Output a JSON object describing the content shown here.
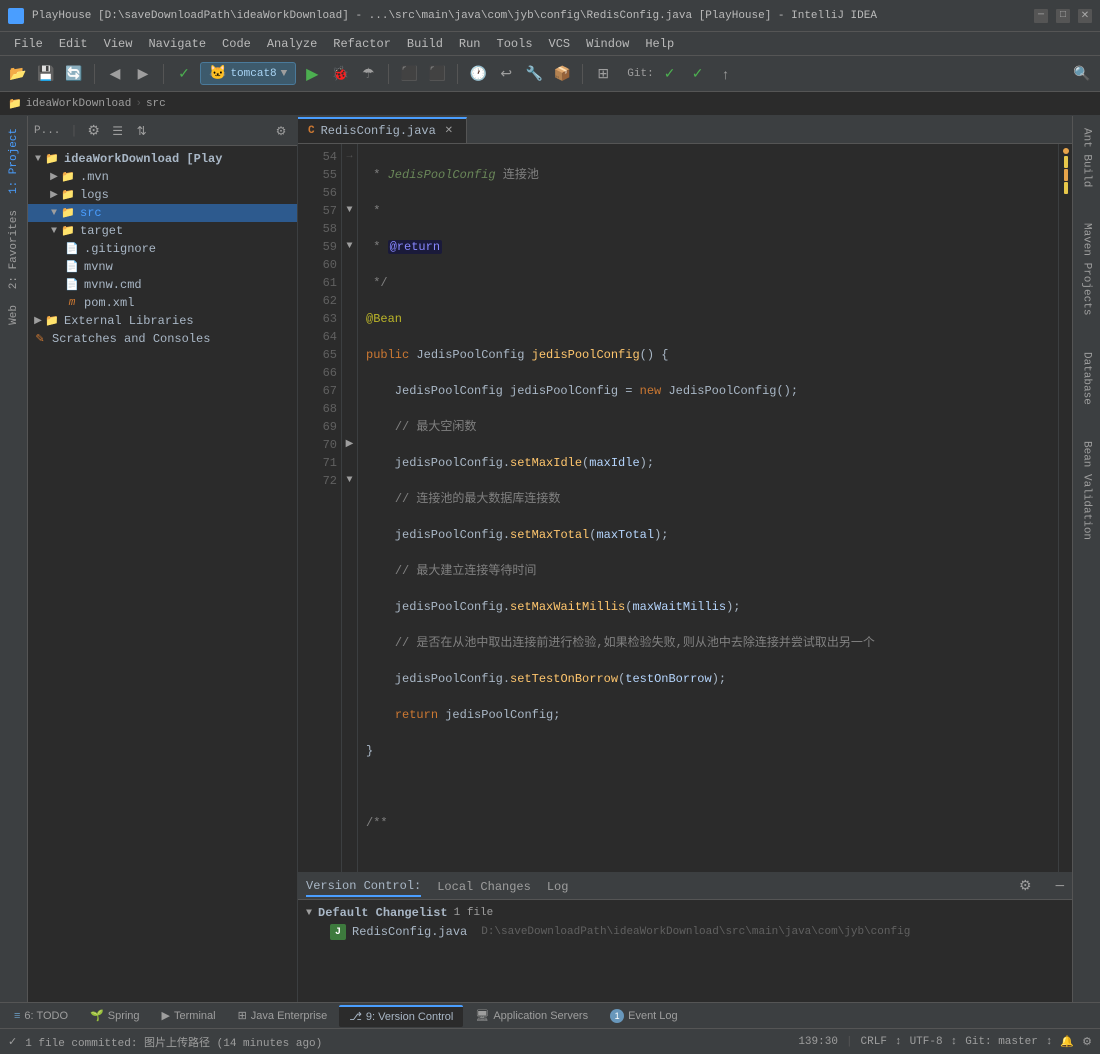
{
  "titleBar": {
    "title": "PlayHouse [D:\\saveDownloadPath\\ideaWorkDownload] - ...\\src\\main\\java\\com\\jyb\\config\\RedisConfig.java [PlayHouse] - IntelliJ IDEA"
  },
  "menuBar": {
    "items": [
      "File",
      "Edit",
      "View",
      "Navigate",
      "Code",
      "Analyze",
      "Refactor",
      "Build",
      "Run",
      "Tools",
      "VCS",
      "Window",
      "Help"
    ]
  },
  "toolbar": {
    "runConfig": "tomcat8",
    "gitLabel": "Git:"
  },
  "breadcrumb": {
    "items": [
      "ideaWorkDownload",
      "src"
    ]
  },
  "sidebar": {
    "projectLabel": "P...",
    "tree": [
      {
        "indent": 0,
        "hasArrow": true,
        "open": true,
        "icon": "folder",
        "label": "ideaWorkDownload [Play",
        "bold": true
      },
      {
        "indent": 1,
        "hasArrow": false,
        "open": false,
        "icon": "folder",
        "label": ".mvn"
      },
      {
        "indent": 1,
        "hasArrow": false,
        "open": false,
        "icon": "folder",
        "label": "logs"
      },
      {
        "indent": 1,
        "hasArrow": true,
        "open": true,
        "icon": "folder",
        "label": "src",
        "selected": true
      },
      {
        "indent": 1,
        "hasArrow": true,
        "open": true,
        "icon": "folder-target",
        "label": "target"
      },
      {
        "indent": 1,
        "hasArrow": false,
        "open": false,
        "icon": "file",
        "label": ".gitignore"
      },
      {
        "indent": 1,
        "hasArrow": false,
        "open": false,
        "icon": "file",
        "label": "mvnw"
      },
      {
        "indent": 1,
        "hasArrow": false,
        "open": false,
        "icon": "file",
        "label": "mvnw.cmd"
      },
      {
        "indent": 1,
        "hasArrow": false,
        "open": false,
        "icon": "maven",
        "label": "pom.xml"
      },
      {
        "indent": 0,
        "hasArrow": true,
        "open": false,
        "icon": "folder",
        "label": "External Libraries"
      },
      {
        "indent": 0,
        "hasArrow": false,
        "open": false,
        "icon": "scratches",
        "label": "Scratches and Consoles"
      }
    ]
  },
  "editorTabs": [
    {
      "label": "RedisConfig.java",
      "active": true,
      "icon": "java"
    }
  ],
  "codeLines": [
    {
      "num": 54,
      "fold": false,
      "text": " * <span class='cn'>JedisPoolConfig</span> 连接池"
    },
    {
      "num": 55,
      "fold": false,
      "text": " *"
    },
    {
      "num": 56,
      "fold": false,
      "text": " * <span class='ret-tag'>@return</span>"
    },
    {
      "num": 57,
      "fold": true,
      "text": " */"
    },
    {
      "num": 58,
      "fold": false,
      "text": "<span class='ann'>@Bean</span>"
    },
    {
      "num": 59,
      "fold": true,
      "text": "<span class='kw'>public</span> JedisPoolConfig <span class='fn'>jedisPoolConfig</span>() {"
    },
    {
      "num": 60,
      "fold": false,
      "text": "    JedisPoolConfig jedisPoolConfig = <span class='kw'>new</span> JedisPoolConfig();"
    },
    {
      "num": 61,
      "fold": false,
      "text": "    <span class='comment'>// 最大空闲数</span>"
    },
    {
      "num": 62,
      "fold": false,
      "text": "    jedisPoolConfig.<span class='fn'>setMaxIdle</span>(<span class='param'>maxIdle</span>);"
    },
    {
      "num": 63,
      "fold": false,
      "text": "    <span class='comment'>// 连接池的最大数据库连接数</span>"
    },
    {
      "num": 64,
      "fold": false,
      "text": "    jedisPoolConfig.<span class='fn'>setMaxTotal</span>(<span class='param'>maxTotal</span>);"
    },
    {
      "num": 65,
      "fold": false,
      "text": "    <span class='comment'>// 最大建立连接等待时间</span>"
    },
    {
      "num": 66,
      "fold": false,
      "text": "    jedisPoolConfig.<span class='fn'>setMaxWaitMillis</span>(<span class='param'>maxWaitMillis</span>);"
    },
    {
      "num": 67,
      "fold": false,
      "text": "    <span class='comment'>// 是否在从池中取出连接前进行检验,如果检验失败,则从池中去除连接并尝试取出另一个</span>"
    },
    {
      "num": 68,
      "fold": false,
      "text": "    jedisPoolConfig.<span class='fn'>setTestOnBorrow</span>(<span class='param'>testOnBorrow</span>);"
    },
    {
      "num": 69,
      "fold": false,
      "text": "    <span class='kw'>return</span> jedisPoolConfig;"
    },
    {
      "num": 70,
      "fold": true,
      "text": "}"
    },
    {
      "num": 71,
      "fold": false,
      "text": ""
    },
    {
      "num": 72,
      "fold": true,
      "text": "/**"
    }
  ],
  "leftPanelTabs": [
    {
      "label": "1: Project",
      "active": true
    },
    {
      "label": "2: Favorites"
    },
    {
      "label": "Web"
    }
  ],
  "rightPanelTabs": [
    {
      "label": "Ant Build"
    },
    {
      "label": "Maven Projects"
    },
    {
      "label": "Database"
    },
    {
      "label": "Bean Validation"
    }
  ],
  "bottomTabs": [
    {
      "label": "Version Control",
      "active": true
    },
    {
      "label": "Local Changes"
    },
    {
      "label": "Log"
    }
  ],
  "versionControl": {
    "changelistName": "Default Changelist",
    "fileCount": "1 file",
    "changedFile": {
      "name": "RedisConfig.java",
      "path": "D:\\saveDownloadPath\\ideaWorkDownload\\src\\main\\java\\com\\jyb\\config"
    }
  },
  "bottomToolbar": {
    "tabs": [
      {
        "number": "6",
        "label": "TODO",
        "icon": "list"
      },
      {
        "label": "Spring",
        "icon": "spring"
      },
      {
        "label": "Terminal",
        "icon": "terminal"
      },
      {
        "label": "Java Enterprise",
        "icon": "je"
      },
      {
        "number": "9",
        "label": "Version Control",
        "active": true
      },
      {
        "label": "Application Servers",
        "icon": "server"
      },
      {
        "number": "1",
        "label": "Event Log",
        "icon": "log"
      }
    ]
  },
  "statusBar": {
    "commit": "1 file committed: 图片上传路径 (14 minutes ago)",
    "position": "139:30",
    "lineEnding": "CRLF",
    "encoding": "UTF-8",
    "gitBranch": "Git: master"
  }
}
